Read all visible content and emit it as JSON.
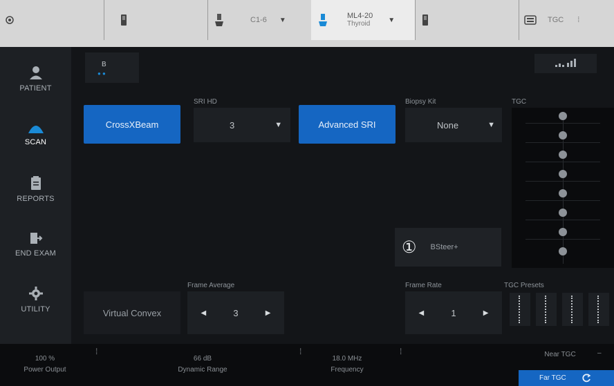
{
  "topbar": {
    "probe_1": "C1-6",
    "probe_2_name": "ML4-20",
    "probe_2_preset": "Thyroid",
    "tgc_label": "TGC"
  },
  "leftnav": {
    "items": [
      {
        "label": "PATIENT",
        "icon": "patient-icon"
      },
      {
        "label": "SCAN",
        "icon": "scan-icon"
      },
      {
        "label": "REPORTS",
        "icon": "reports-icon"
      },
      {
        "label": "END EXAM",
        "icon": "end-exam-icon"
      },
      {
        "label": "UTILITY",
        "icon": "utility-icon"
      }
    ]
  },
  "main": {
    "mode_tab": "B",
    "crossxbeam_label": "CrossXBeam",
    "sri_hd_label": "SRI HD",
    "sri_hd_value": "3",
    "advanced_sri_label": "Advanced SRI",
    "biopsy_kit_label": "Biopsy Kit",
    "biopsy_kit_value": "None",
    "tgc_label": "TGC",
    "bsteer_number": "①",
    "bsteer_label": "BSteer+",
    "frame_average_label": "Frame Average",
    "frame_average_value": "3",
    "virtual_convex_label": "Virtual Convex",
    "frame_rate_label": "Frame Rate",
    "frame_rate_value": "1",
    "tgc_presets_label": "TGC Presets"
  },
  "bottom": {
    "power_output_value": "100 %",
    "power_output_label": "Power Output",
    "dynamic_range_value": "66 dB",
    "dynamic_range_label": "Dynamic Range",
    "frequency_value": "18.0 MHz",
    "frequency_label": "Frequency",
    "near_tgc_label": "Near TGC",
    "far_tgc_label": "Far TGC"
  },
  "colors": {
    "accent_blue": "#1566c2",
    "active_nav": "#1a8ad6"
  }
}
